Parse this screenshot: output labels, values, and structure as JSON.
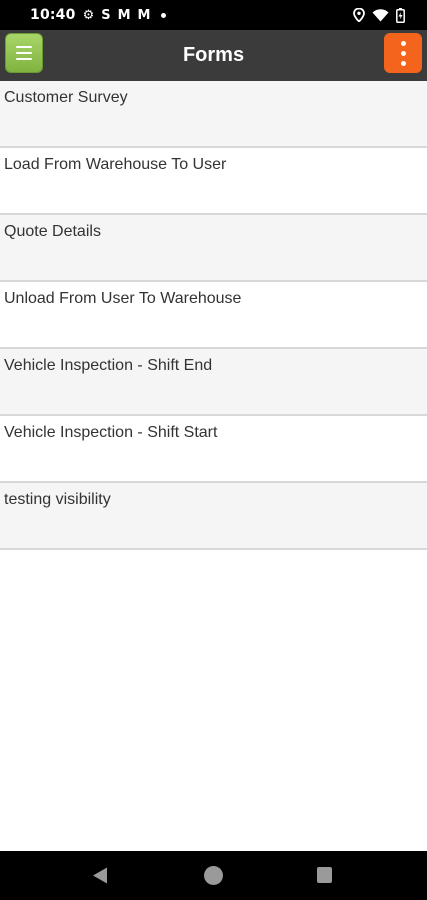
{
  "status_bar": {
    "time": "10:40",
    "left_icons": [
      "gear-icon",
      "s-notification-icon",
      "gmail-icon",
      "gmail-icon",
      "dot-icon"
    ],
    "right_icons": [
      "location-icon",
      "wifi-icon",
      "battery-icon"
    ]
  },
  "header": {
    "title": "Forms",
    "menu_icon": "hamburger-menu-icon",
    "overflow_icon": "vertical-dots-icon",
    "colors": {
      "bar": "#3b3b3b",
      "menu_button": "#8cc34a",
      "overflow_button": "#f4641d"
    }
  },
  "forms": [
    {
      "label": "Customer Survey"
    },
    {
      "label": "Load From Warehouse To User"
    },
    {
      "label": "Quote Details"
    },
    {
      "label": "Unload From User To Warehouse"
    },
    {
      "label": "Vehicle Inspection - Shift End"
    },
    {
      "label": "Vehicle Inspection - Shift Start"
    },
    {
      "label": "testing visibility"
    }
  ],
  "nav_bar": {
    "icons": [
      "back-icon",
      "home-icon",
      "recents-icon"
    ]
  }
}
